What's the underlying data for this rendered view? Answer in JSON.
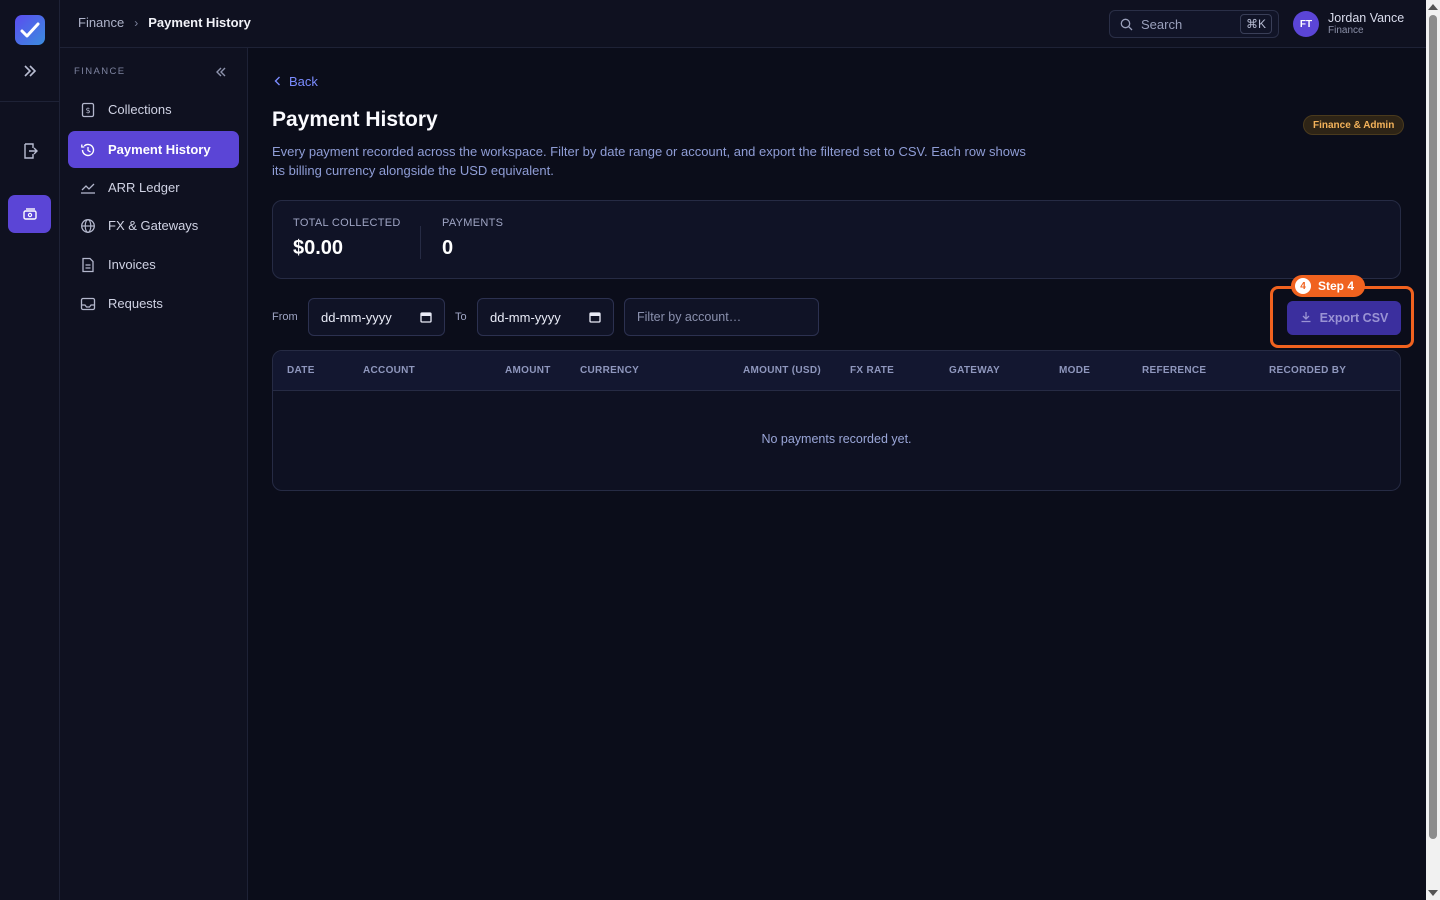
{
  "header": {
    "breadcrumb": [
      "Finance",
      "Payment History"
    ],
    "search_placeholder": "Search",
    "search_shortcut": "⌘K",
    "user": {
      "initials": "FT",
      "name": "Jordan Vance",
      "role": "Finance"
    }
  },
  "rail": {
    "items": [
      {
        "icon": "expand-icon"
      },
      {
        "icon": "door-exit-icon"
      },
      {
        "icon": "wallet-icon",
        "active": true
      }
    ]
  },
  "sidebar": {
    "section_title": "FINANCE",
    "items": [
      {
        "label": "Collections",
        "icon": "receipt-icon"
      },
      {
        "label": "Payment History",
        "icon": "history-icon",
        "active": true
      },
      {
        "label": "ARR Ledger",
        "icon": "chart-icon"
      },
      {
        "label": "FX & Gateways",
        "icon": "globe-icon"
      },
      {
        "label": "Invoices",
        "icon": "document-icon"
      },
      {
        "label": "Requests",
        "icon": "inbox-icon"
      }
    ]
  },
  "main": {
    "back_label": "Back",
    "title": "Payment History",
    "badge": "Finance & Admin",
    "description": "Every payment recorded across the workspace. Filter by date range or account, and export the filtered set to CSV. Each row shows its billing currency alongside the USD equivalent.",
    "stats": [
      {
        "label": "TOTAL COLLECTED",
        "value": "$0.00"
      },
      {
        "label": "PAYMENTS",
        "value": "0"
      }
    ],
    "filters": {
      "from_label": "From",
      "from_value": "dd-mm-yyyy",
      "to_label": "To",
      "to_value": "dd-mm-yyyy",
      "account_placeholder": "Filter by account…"
    },
    "export_label": "Export CSV",
    "step_badge": {
      "number": "4",
      "label": "Step 4"
    },
    "table": {
      "columns": [
        "DATE",
        "ACCOUNT",
        "AMOUNT",
        "CURRENCY",
        "AMOUNT (USD)",
        "FX RATE",
        "GATEWAY",
        "MODE",
        "REFERENCE",
        "RECORDED BY"
      ],
      "empty_message": "No payments recorded yet."
    }
  },
  "colors": {
    "accent": "#5b45d6",
    "highlight": "#f0621f",
    "link": "#7b8cff",
    "badge_text": "#f4b35b"
  }
}
